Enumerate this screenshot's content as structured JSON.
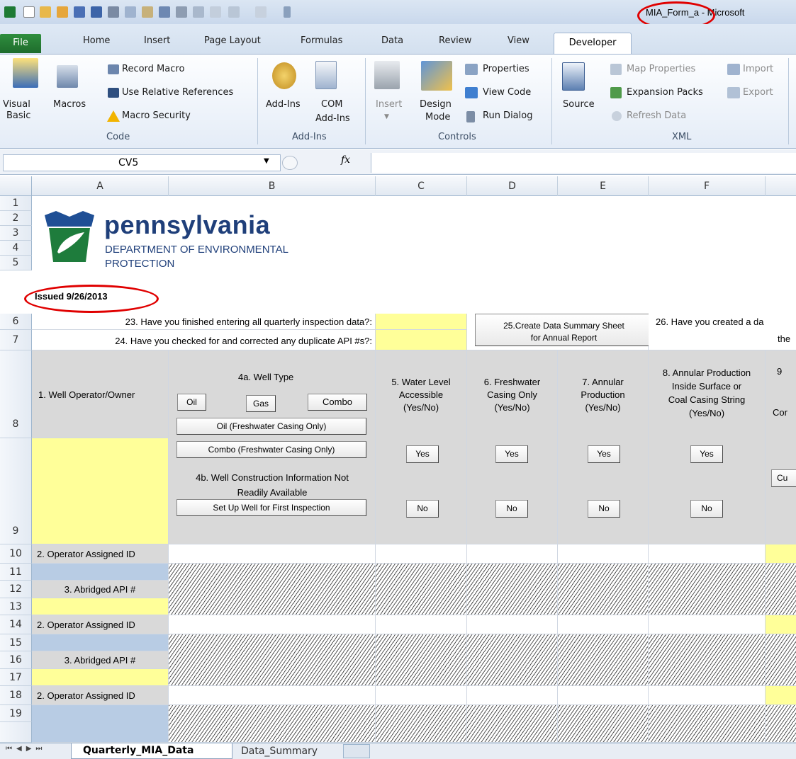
{
  "window": {
    "title": "MIA_Form_a - Microsoft"
  },
  "tabs": {
    "file": "File",
    "home": "Home",
    "insert": "Insert",
    "page_layout": "Page Layout",
    "formulas": "Formulas",
    "data": "Data",
    "review": "Review",
    "view": "View",
    "developer": "Developer"
  },
  "ribbon": {
    "code": {
      "visual_basic_1": "Visual",
      "visual_basic_2": "Basic",
      "macros": "Macros",
      "record_macro": "Record Macro",
      "relative": "Use Relative References",
      "security": "Macro Security",
      "label": "Code"
    },
    "addins": {
      "addins": "Add-Ins",
      "com_1": "COM",
      "com_2": "Add-Ins",
      "label": "Add-Ins"
    },
    "controls": {
      "insert": "Insert",
      "design_1": "Design",
      "design_2": "Mode",
      "properties": "Properties",
      "view_code": "View Code",
      "run_dialog": "Run Dialog",
      "label": "Controls"
    },
    "xml": {
      "source": "Source",
      "map_props": "Map Properties",
      "expansion": "Expansion Packs",
      "refresh": "Refresh Data",
      "import": "Import",
      "export": "Export",
      "label": "XML"
    }
  },
  "formula_bar": {
    "name_box": "CV5",
    "fx": "fx"
  },
  "columns": [
    "A",
    "B",
    "C",
    "D",
    "E",
    "F"
  ],
  "rows": [
    "1",
    "2",
    "3",
    "4",
    "5",
    "6",
    "7",
    "8",
    "9",
    "10",
    "11",
    "12",
    "13",
    "14",
    "15",
    "16",
    "17",
    "18",
    "19"
  ],
  "logo": {
    "name": "pennsylvania",
    "line1": "DEPARTMENT OF ENVIRONMENTAL",
    "line2": "PROTECTION"
  },
  "sheet": {
    "issued": "Issued 9/26/2013",
    "q23": "23. Have you finished entering all quarterly inspection data?:",
    "q24": "24. Have you checked for and corrected any duplicate API #s?:",
    "btn25_1": "25.Create Data Summary Sheet",
    "btn25_2": "for Annual Report",
    "q26_1": "26. Have you created a da",
    "q26_2": "the",
    "h1": "1. Well Operator/Owner",
    "h4a": "4a. Well Type",
    "btn_oil": "Oil",
    "btn_gas": "Gas",
    "btn_combo": "Combo",
    "btn_oil_fw": "Oil (Freshwater Casing Only)",
    "btn_combo_fw": "Combo (Freshwater Casing Only)",
    "h4b_1": "4b. Well Construction Information Not",
    "h4b_2": "Readily Available",
    "btn_setup": "Set Up Well for First Inspection",
    "h5": [
      "5. Water Level",
      "Accessible",
      "(Yes/No)"
    ],
    "h6": [
      "6. Freshwater",
      "Casing Only",
      "(Yes/No)"
    ],
    "h7": [
      "7. Annular",
      "Production",
      "(Yes/No)"
    ],
    "h8": [
      "8. Annular Production",
      "Inside Surface or",
      "Coal Casing String",
      "(Yes/No)"
    ],
    "h9_1": "9",
    "h9_2": "Cor",
    "h9_btn": "Cu",
    "yes": "Yes",
    "no": "No",
    "op_id": "2. Operator Assigned ID",
    "api": "3. Abridged API #"
  },
  "sheet_tabs": [
    "Quarterly_MIA_Data",
    "Data_Summary"
  ]
}
